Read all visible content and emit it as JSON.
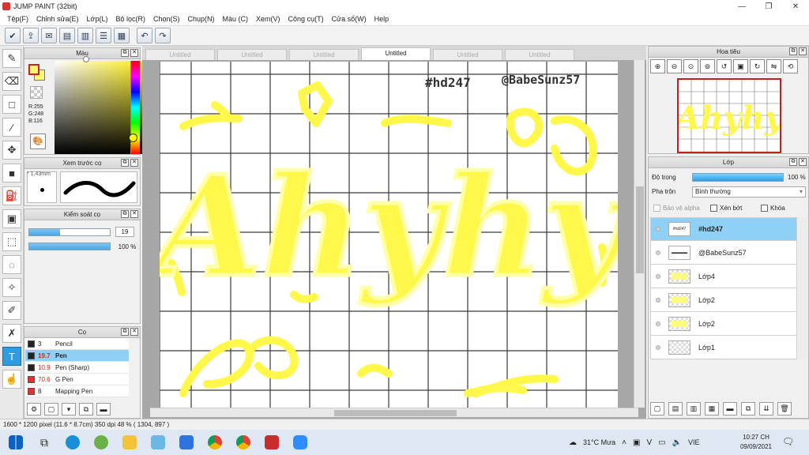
{
  "window": {
    "title": "JUMP PAINT (32bit)",
    "minimize": "—",
    "restore": "❐",
    "close": "✕"
  },
  "menu": [
    "Tệp(F)",
    "Chỉnh sửa(E)",
    "Lớp(L)",
    "Bộ lọc(R)",
    "Chọn(S)",
    "Chụp(N)",
    "Màu (C)",
    "Xem(V)",
    "Công cụ(T)",
    "Cửa sổ(W)",
    "Help"
  ],
  "toolbar": {
    "buttons": [
      "check-icon",
      "share-icon",
      "comment-icon",
      "chat-icon",
      "document-icon",
      "list-icon",
      "grid-icon"
    ],
    "undo_icon": "↶",
    "redo_icon": "↷"
  },
  "tools": [
    "pen-icon",
    "eraser-icon",
    "rectangle-icon",
    "brush-icon",
    "move-icon",
    "fill-rect-icon",
    "bucket-icon",
    "gradient-icon",
    "select-rect-icon",
    "lasso-icon",
    "magic-wand-icon",
    "select-pen-icon",
    "select-eraser-icon",
    "text-icon",
    "hand-icon"
  ],
  "color_panel": {
    "title": "Màu",
    "r": "R:255",
    "g": "G:248",
    "b": "B:116",
    "fg_color": "#fff874",
    "bg_color": "#fff874"
  },
  "preview_panel": {
    "title": "Xem trước cọ",
    "size": "* 1.43mm"
  },
  "brush_control": {
    "title": "Kiểm soát cọ",
    "size_value": "19",
    "size_fraction": 0.38,
    "opacity_value": "100 %",
    "opacity_fraction": 1.0
  },
  "brush_list": {
    "title": "Cọ",
    "items": [
      {
        "size": "3",
        "name": "Pencil",
        "color": "#222222",
        "size_color": "#222"
      },
      {
        "size": "19.7",
        "name": "Pen",
        "color": "#222222",
        "size_color": "#d22",
        "selected": true
      },
      {
        "size": "10.9",
        "name": "Pen (Sharp)",
        "color": "#222222",
        "size_color": "#d22"
      },
      {
        "size": "70.6",
        "name": "G Pen",
        "color": "#e03030",
        "size_color": "#d22"
      },
      {
        "size": "8",
        "name": "Mapping Pen",
        "color": "#e03030",
        "size_color": "#222"
      }
    ]
  },
  "tabs": [
    {
      "label": "Untitled",
      "active": false
    },
    {
      "label": "Untitled",
      "active": false
    },
    {
      "label": "Untitled",
      "active": false
    },
    {
      "label": "Untitled",
      "active": true
    },
    {
      "label": "Untitled",
      "active": false
    },
    {
      "label": "Untitled",
      "active": false
    }
  ],
  "canvas": {
    "hashtag": "#hd247",
    "handle": "@BabeSunz57",
    "lettering": "Ahyhy",
    "stroke_color": "#fff84a"
  },
  "navigator": {
    "title": "Hoa tiêu",
    "thumb_lettering": "Ahyhy"
  },
  "layer_panel": {
    "title": "Lớp",
    "opacity_label": "Độ trong",
    "opacity_value": "100 %",
    "blend_label": "Pha trộn",
    "blend_value": "Bình thường",
    "protect_alpha": "Bảo vệ alpha",
    "clipping": "Xén bớt",
    "lock": "Khóa",
    "layers": [
      {
        "name": "#hd247",
        "thumb": "txt",
        "thumb_text": "#hd247",
        "selected": true
      },
      {
        "name": "@BabeSunz57",
        "thumb": "txt",
        "thumb_text": "▬▬▬▬",
        "selected": false
      },
      {
        "name": "Lớp4",
        "thumb": "yel",
        "selected": false
      },
      {
        "name": "Lớp2",
        "thumb": "yel",
        "selected": false
      },
      {
        "name": "Lớp2",
        "thumb": "yel",
        "selected": false
      },
      {
        "name": "Lớp1",
        "thumb": "grid",
        "selected": false
      }
    ]
  },
  "status": "1600 * 1200 pixel   (11.6 * 8.7cm)   350 dpi   48 %   ( 1304, 897 )",
  "taskbar": {
    "weather": "31°C  Mưa",
    "lang": "VIE",
    "time": "10:27 CH",
    "date": "09/09/2021",
    "apps": [
      "windows-icon",
      "search-icon",
      "edge-icon",
      "app-icon",
      "files-icon",
      "paint-icon",
      "zalo-icon",
      "chrome-icon",
      "chrome-icon",
      "jump-paint-icon",
      "zoom-icon"
    ]
  }
}
